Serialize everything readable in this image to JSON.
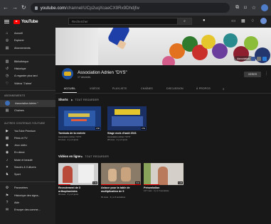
{
  "browser": {
    "url_domain": "youtube.com",
    "url_path": "/channel/UCp2uqXcaeCX9Rx9Dhdjfw",
    "nav_icons": [
      "back-icon",
      "forward-icon",
      "reload-icon"
    ],
    "right_icons": [
      "extensions-icon",
      "bookmark-icon",
      "star-icon"
    ]
  },
  "youtube": {
    "logo_text": "YouTube",
    "logo_suffix": "FR",
    "search_placeholder": "Rechercher",
    "accent": "#ff0000"
  },
  "sidebar": {
    "main_items": [
      {
        "icon": "⌂",
        "label": "Accueil"
      },
      {
        "icon": "◎",
        "label": "Explorer"
      },
      {
        "icon": "▤",
        "label": "Abonnements"
      }
    ],
    "library_items": [
      {
        "icon": "▥",
        "label": "Bibliothèque"
      },
      {
        "icon": "↺",
        "label": "Historique"
      },
      {
        "icon": "◷",
        "label": "À regarder plus tard"
      },
      {
        "icon": "♡",
        "label": "Vidéos \"J'aime\""
      }
    ],
    "subs_header": "ABONNEMENTS",
    "subs_items": [
      {
        "label": "Association Adrien \""
      },
      {
        "label": "Chaînes"
      }
    ],
    "more_header": "AUTRES CONTENUS YOUTUBE",
    "more_items": [
      {
        "icon": "▶",
        "label": "YouTube Premium"
      },
      {
        "icon": "▦",
        "label": "Films et TV"
      },
      {
        "icon": "◆",
        "label": "Jeux vidéo"
      },
      {
        "icon": "◉",
        "label": "En direct"
      },
      {
        "icon": "♪",
        "label": "Mode et beauté"
      },
      {
        "icon": "✦",
        "label": "Savoirs & Cultures"
      },
      {
        "icon": "♞",
        "label": "Sport"
      }
    ],
    "footer_items": [
      {
        "icon": "⚙",
        "label": "Paramètres"
      },
      {
        "icon": "⚑",
        "label": "Historique des signa..."
      },
      {
        "icon": "?",
        "label": "Aide"
      },
      {
        "icon": "✉",
        "label": "Envoyer des comme..."
      }
    ]
  },
  "channel": {
    "name": "Association Adrien \"DYS\"",
    "subscribers": "17 abonnés",
    "manage_button": "GÉRER",
    "banner_pill": "Association",
    "tabs": [
      "ACCUEIL",
      "VIDÉOS",
      "PLAYLISTS",
      "CHAÎNES",
      "DISCUSSION",
      "À PROPOS"
    ]
  },
  "shorts": {
    "title": "Shorts",
    "play_all": "TOUT REGARDER",
    "videos": [
      {
        "title": "Tombola de la rentrée",
        "channel": "Association Adrien \"DYS\"",
        "meta": "16 vues · il y a 3 jours",
        "duration": "0:58"
      },
      {
        "title": "Stage mois d'août 2021",
        "channel": "Association Adrien \"DYS\"",
        "meta": "28 vues · il y a 3 jours",
        "duration": "0:59"
      }
    ]
  },
  "videos": {
    "title": "Vidéos en ligne",
    "play_all": "TOUT REGARDER",
    "items": [
      {
        "title": "Recrutement de 3 orthophonistes",
        "meta": "39 vues · il y a 3 jours",
        "duration": "1:09",
        "progress": 0.3
      },
      {
        "title": "Astuce pour la table de multiplication de 9",
        "meta": "61 vues · il y a 3 semaines",
        "duration": "0:34",
        "progress": 1.0
      },
      {
        "title": "Présentation",
        "meta": "117 vues · il y a 3 semaines",
        "duration": "1:26",
        "progress": 0.4
      }
    ]
  }
}
